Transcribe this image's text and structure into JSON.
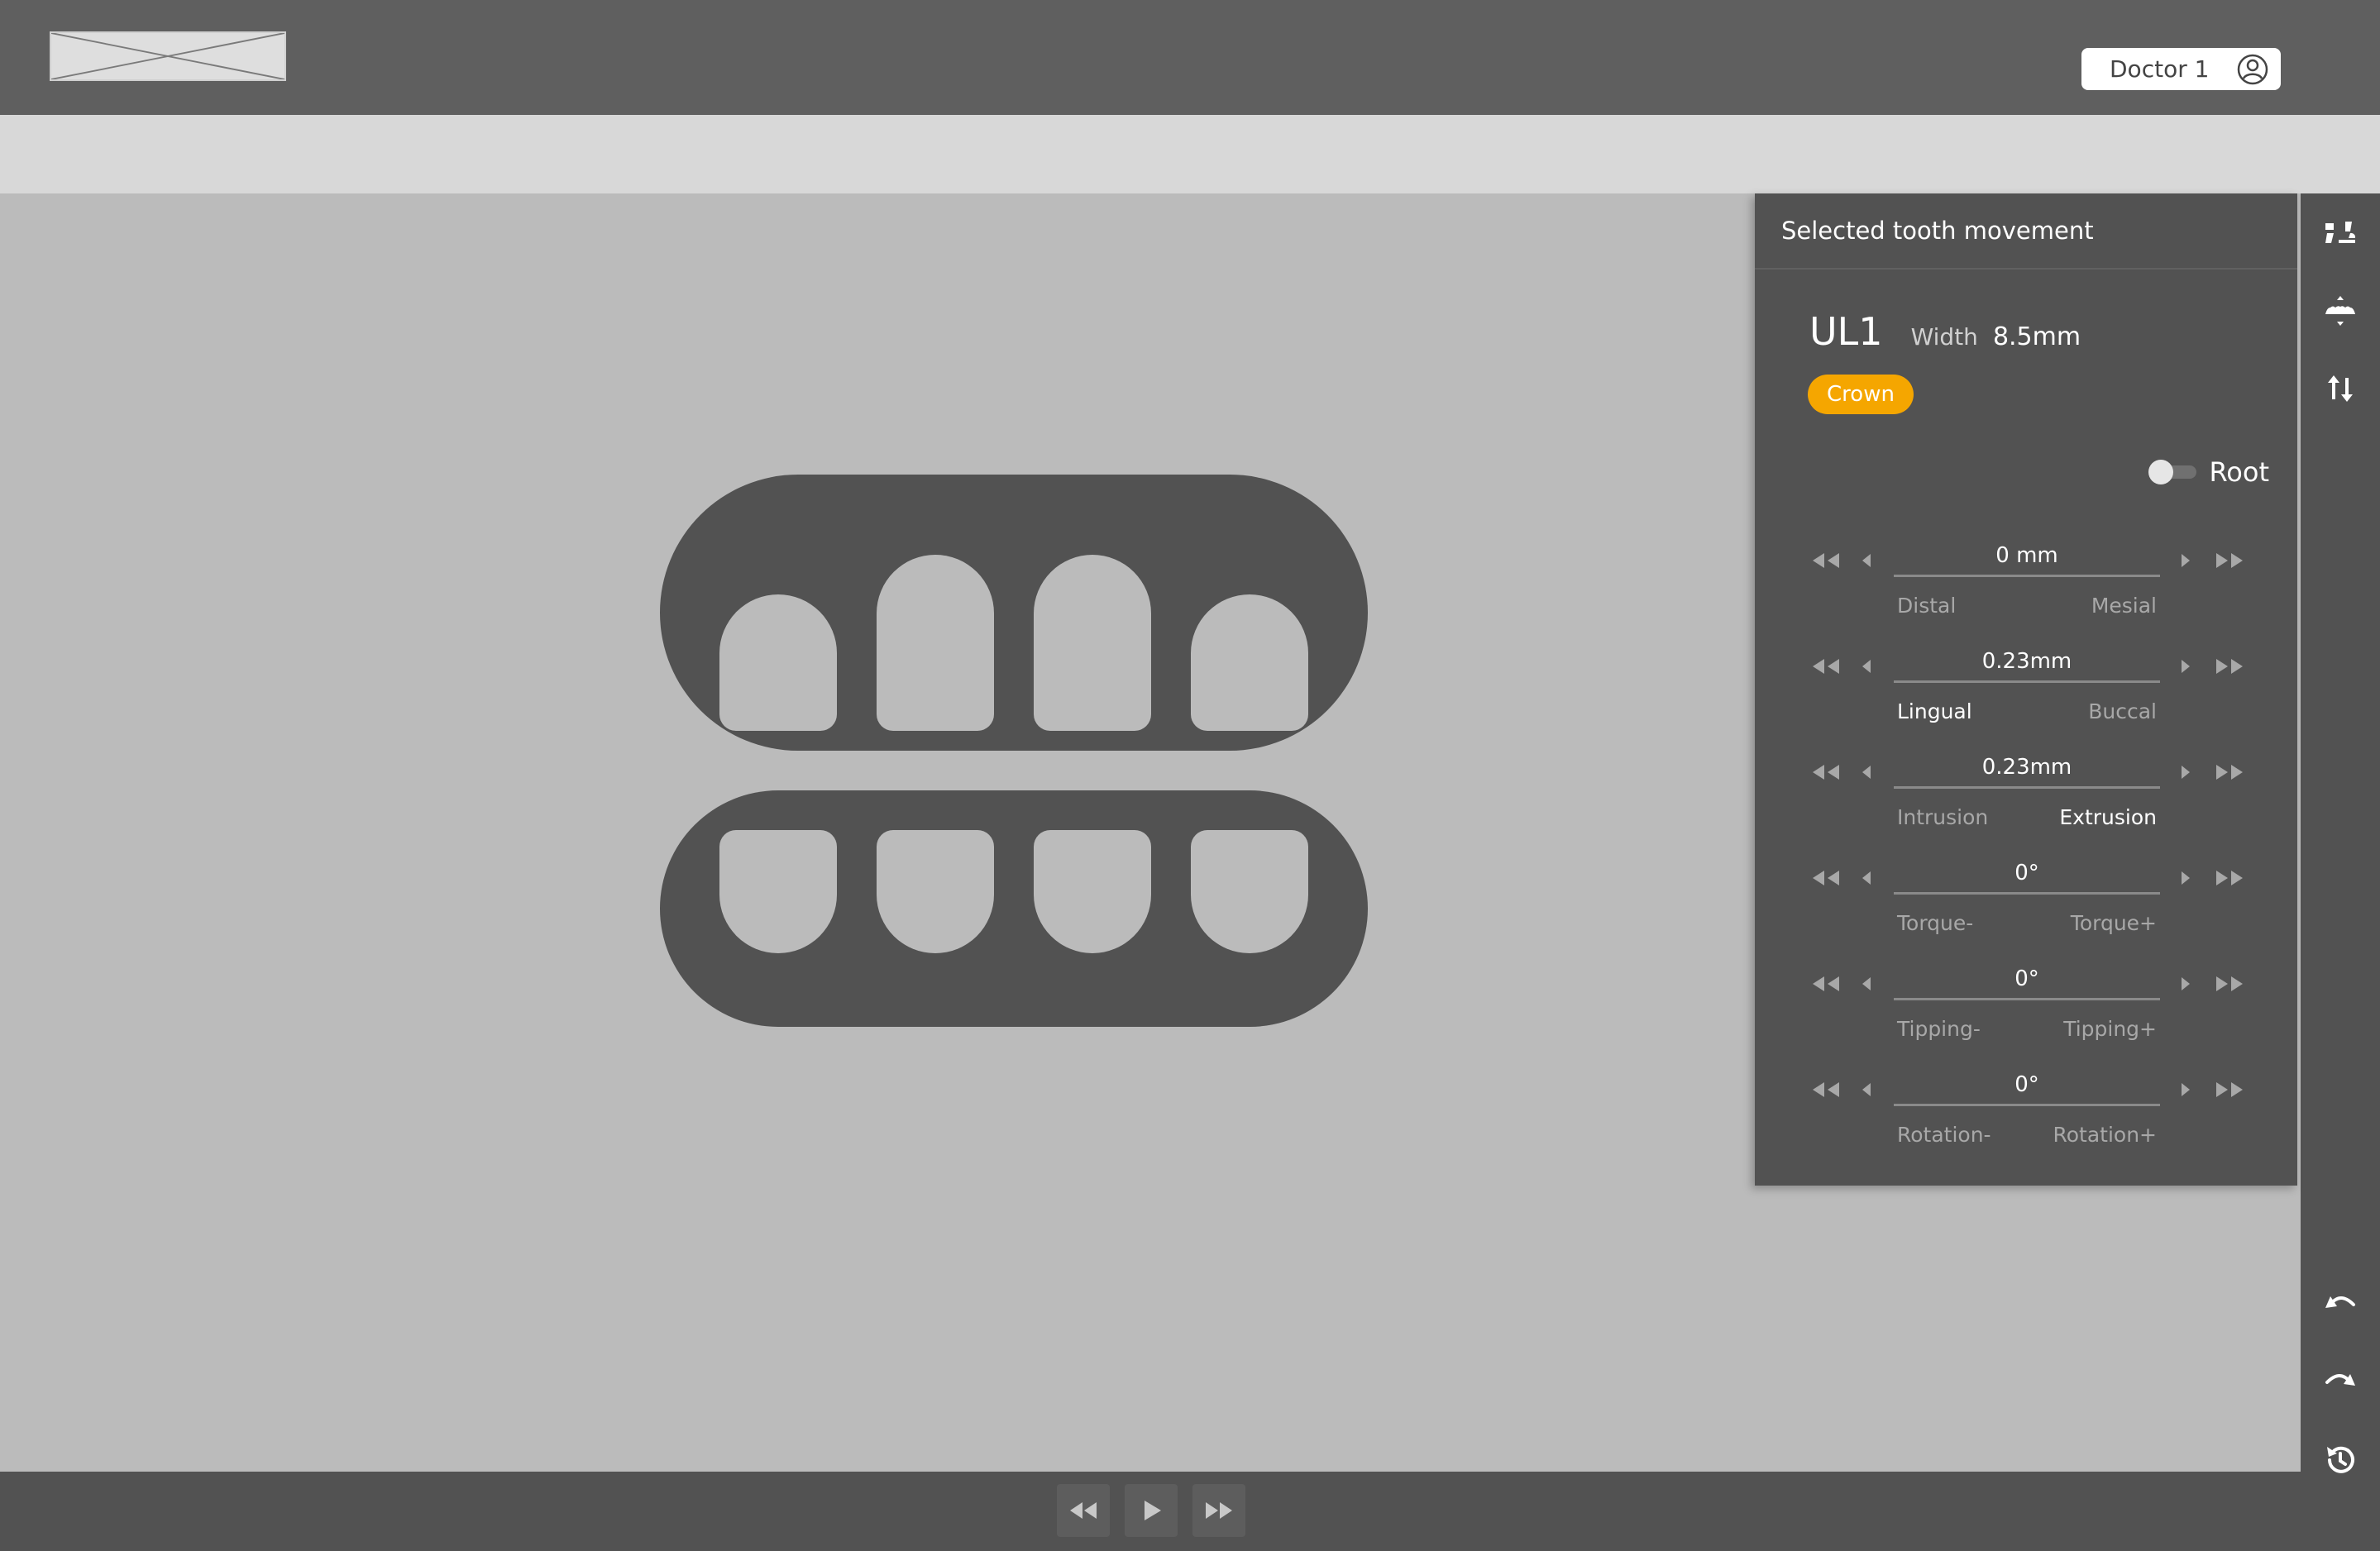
{
  "header": {
    "logo_icon": "image-placeholder-icon",
    "user_name": "Doctor 1",
    "user_icon": "user-circle-icon"
  },
  "panel": {
    "title": "Selected tooth movement",
    "tooth_id": "UL1",
    "width_label": "Width",
    "width_value": "8.5mm",
    "badge": "Crown",
    "badge_color": "#f5a600",
    "toggle_label": "Root",
    "toggle_on": false,
    "controls": [
      {
        "value": "0 mm",
        "left": "Distal",
        "right": "Mesial"
      },
      {
        "value": "0.23mm",
        "left": "Lingual",
        "right": "Buccal"
      },
      {
        "value": "0.23mm",
        "left": "Intrusion",
        "right": "Extrusion"
      },
      {
        "value": "0°",
        "left": "Torque-",
        "right": "Torque+"
      },
      {
        "value": "0°",
        "left": "Tipping-",
        "right": "Tipping+"
      },
      {
        "value": "0°",
        "left": "Rotation-",
        "right": "Rotation+"
      }
    ]
  },
  "right_toolbar": {
    "top_icons": [
      "teeth-view-icon",
      "arch-view-icon",
      "move-vertical-icon"
    ],
    "bottom_icons": [
      "undo-icon",
      "redo-icon",
      "history-icon"
    ]
  },
  "playback": {
    "icons": [
      "rewind-icon",
      "play-icon",
      "fast-forward-icon"
    ]
  }
}
